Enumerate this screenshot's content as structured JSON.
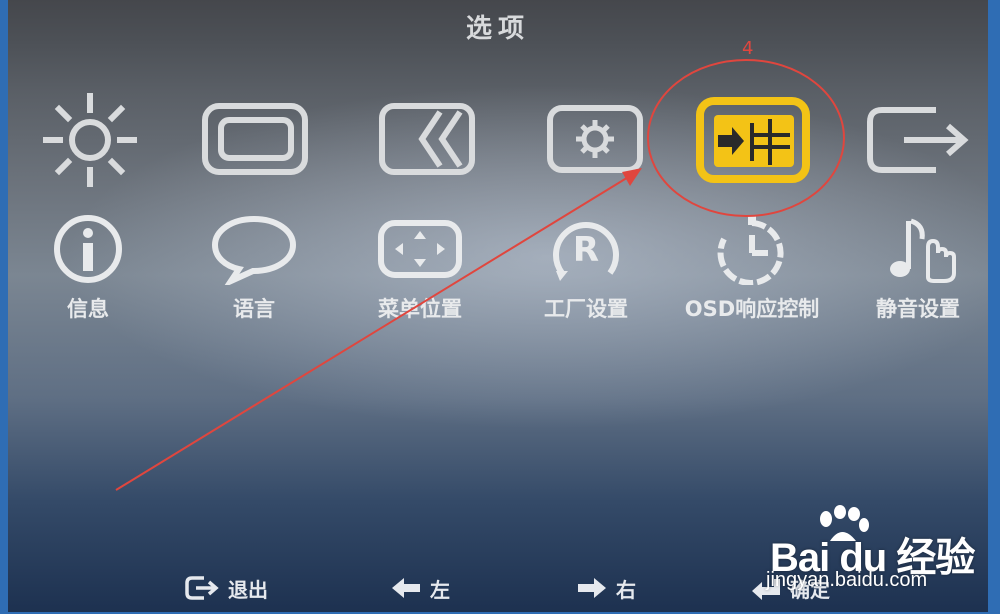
{
  "osd": {
    "title": "选项",
    "top_icons": [
      {
        "name": "brightness-icon",
        "selected": false
      },
      {
        "name": "picture-icon",
        "selected": false
      },
      {
        "name": "color-icon",
        "selected": false
      },
      {
        "name": "settings-icon",
        "selected": false
      },
      {
        "name": "options-icon",
        "selected": true
      },
      {
        "name": "exit-icon",
        "selected": false
      }
    ],
    "sub_items": [
      {
        "icon": "info-icon",
        "label": "信息"
      },
      {
        "icon": "speech-bubble-icon",
        "label": "语言"
      },
      {
        "icon": "menu-position-icon",
        "label": "菜单位置"
      },
      {
        "icon": "factory-reset-icon",
        "label": "工厂设置"
      },
      {
        "icon": "timer-icon",
        "label": "OSD响应控制"
      },
      {
        "icon": "mute-music-icon",
        "label": "静音设置"
      }
    ],
    "bottom_hints": [
      {
        "icon": "exit-arrow-icon",
        "label": "退出"
      },
      {
        "icon": "left-arrow-icon",
        "label": "左"
      },
      {
        "icon": "right-arrow-icon",
        "label": "右"
      },
      {
        "icon": "enter-icon",
        "label": "确定"
      }
    ]
  },
  "annotation": {
    "number": "4",
    "color": "#e0463e"
  },
  "watermark": {
    "brand": "Bai du 经验",
    "url": "jingyan.baidu.com"
  },
  "colors": {
    "icon_normal": "#d9dbdd",
    "icon_selected": "#f3c316",
    "background_bottom": "#1d3150"
  }
}
